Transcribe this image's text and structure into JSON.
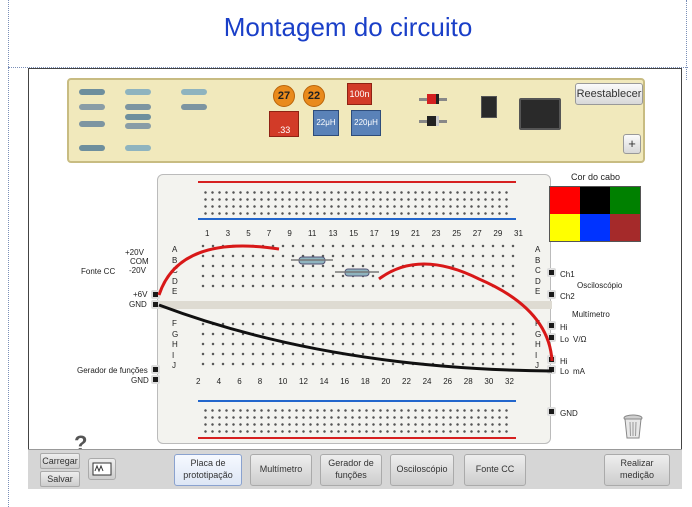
{
  "page": {
    "title": "Montagem do circuito"
  },
  "components": {
    "reset_label": "Reestablecer",
    "plus_label": "+",
    "capacitors": [
      {
        "label": "27",
        "color": "#e98a1c"
      },
      {
        "label": "22",
        "color": "#e98a1c"
      },
      {
        "label": "100n",
        "color": "#d23b28"
      },
      {
        "label": ".33",
        "color": "#d23b28"
      },
      {
        "label": "22μH",
        "color": "#5a82b8"
      },
      {
        "label": "220μH",
        "color": "#5a82b8"
      }
    ]
  },
  "breadboard": {
    "rows_top": [
      "A",
      "B",
      "C",
      "D",
      "E"
    ],
    "rows_bottom": [
      "F",
      "G",
      "H",
      "I",
      "J"
    ],
    "cols_top": [
      "1",
      "3",
      "5",
      "7",
      "9",
      "11",
      "13",
      "15",
      "17",
      "19",
      "21",
      "23",
      "25",
      "27",
      "29",
      "31"
    ],
    "cols_bottom": [
      "2",
      "4",
      "6",
      "8",
      "10",
      "12",
      "14",
      "16",
      "18",
      "20",
      "22",
      "24",
      "26",
      "28",
      "30",
      "32"
    ],
    "left_labels": {
      "p20": "+20V",
      "com": "COM",
      "m20": "-20V",
      "fonte": "Fonte CC",
      "p6": "+6V",
      "gnd": "GND",
      "gerador": "Gerador de funções",
      "gerador_gnd": "GND"
    },
    "right_labels": {
      "ch1": "Ch1",
      "ch2": "Ch2",
      "osciloscopio": "Osciloscópio",
      "multimetro": "Multímetro",
      "hi_top": "Hi",
      "lo_top": "Lo",
      "v_ohm": "V/Ω",
      "hi_bot": "Hi",
      "lo_bot": "Lo",
      "ma": "mA",
      "gnd": "GND"
    }
  },
  "wire_palette": {
    "title": "Cor do cabo",
    "colors": [
      "#ff0000",
      "#000000",
      "#008000",
      "#ffff00",
      "#0033ff",
      "#a52a2a"
    ]
  },
  "toolbar": {
    "carregar": "Carregar",
    "salvar": "Salvar",
    "help": "?",
    "tabs": [
      {
        "line1": "Placa de",
        "line2": "prototipação"
      },
      {
        "line1": "Multímetro",
        "line2": ""
      },
      {
        "line1": "Gerador de",
        "line2": "funções"
      },
      {
        "line1": "Osciloscópio",
        "line2": ""
      },
      {
        "line1": "Fonte CC",
        "line2": ""
      }
    ],
    "measure": {
      "line1": "Realizar",
      "line2": "medição"
    }
  }
}
